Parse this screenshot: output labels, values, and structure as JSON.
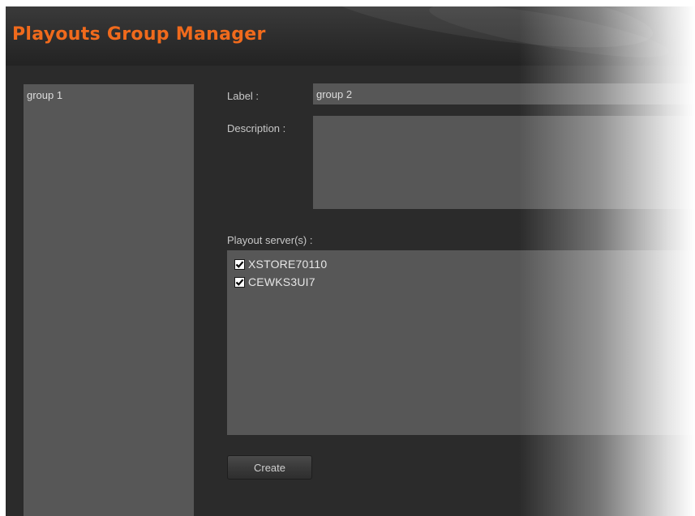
{
  "app": {
    "title": "Playouts Group Manager",
    "accent_color": "#f06a1c"
  },
  "groups": {
    "items": [
      {
        "label": "group 1"
      }
    ]
  },
  "form": {
    "label_caption": "Label :",
    "label_value": "group 2",
    "description_caption": "Description :",
    "description_value": "",
    "servers_caption": "Playout server(s) :",
    "servers": [
      {
        "name": "XSTORE70110",
        "checked": true,
        "icon": "checkbox-checked-icon"
      },
      {
        "name": "CEWKS3UI7",
        "checked": true,
        "icon": "checkbox-checked-icon"
      }
    ],
    "create_label": "Create"
  }
}
